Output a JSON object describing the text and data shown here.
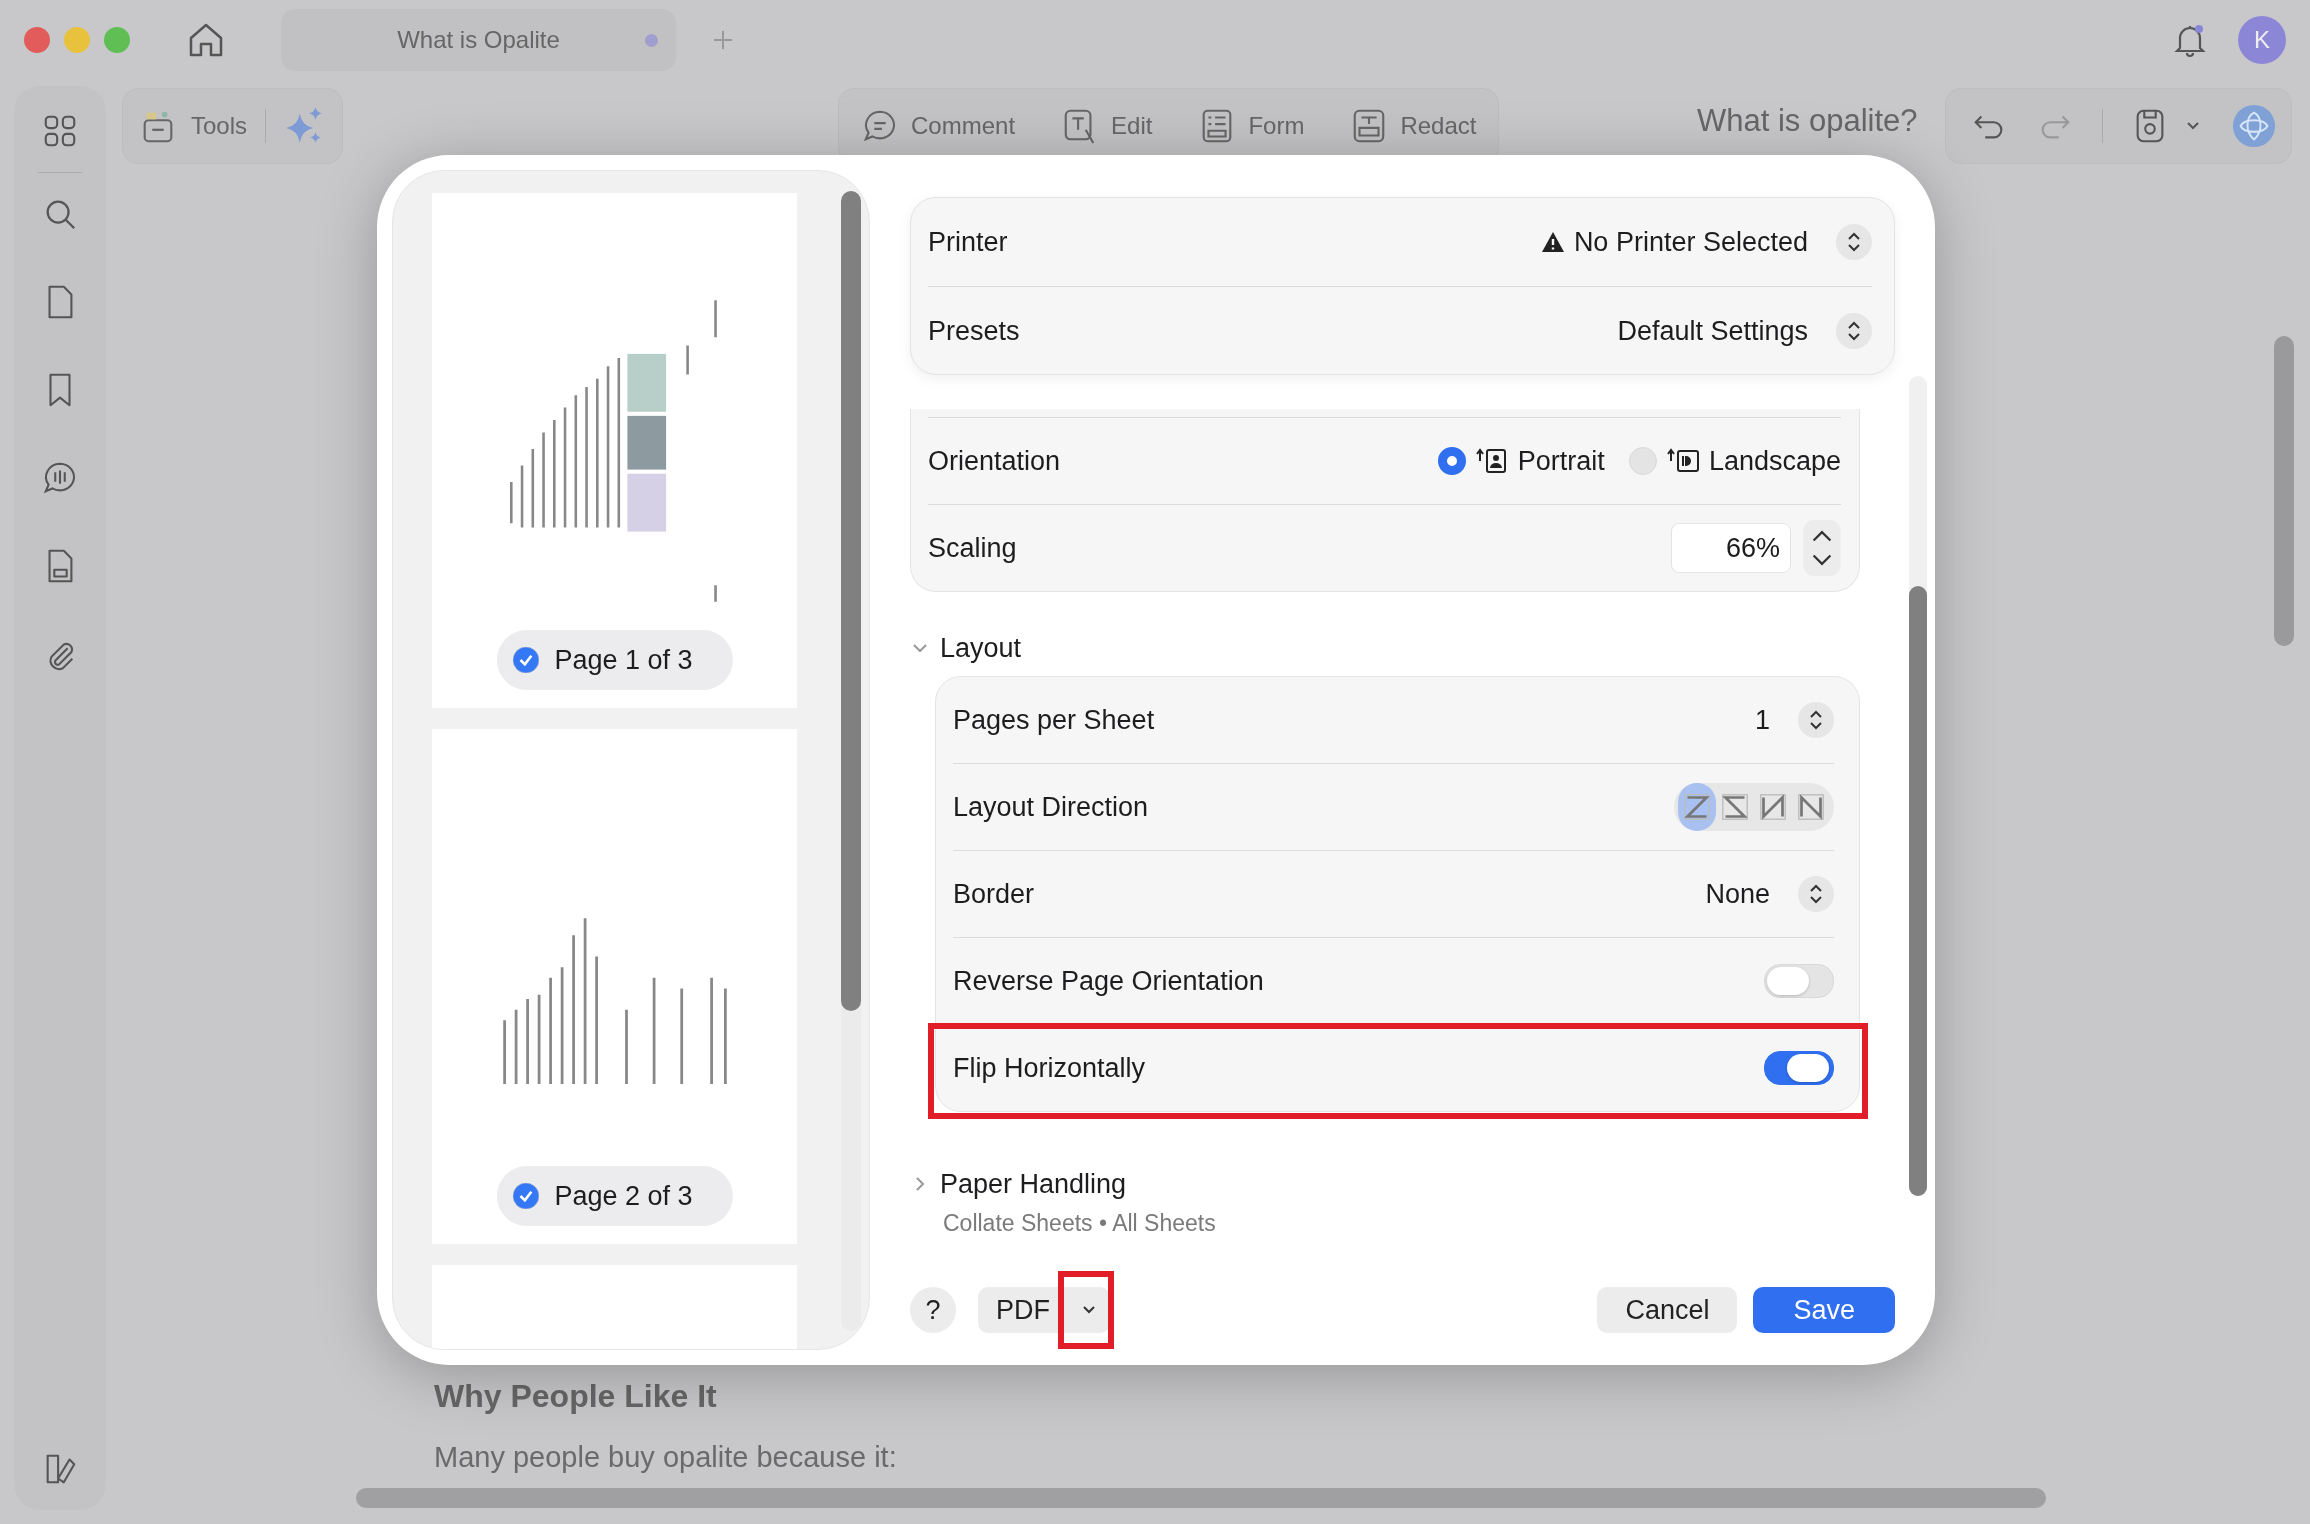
{
  "window": {
    "tab_title": "What is Opalite",
    "tab_unsaved": true,
    "notification": true,
    "avatar": "K"
  },
  "toolbar": {
    "tools_label": "Tools",
    "modes": [
      {
        "label": "Comment",
        "kind": "comment"
      },
      {
        "label": "Edit",
        "kind": "edit"
      },
      {
        "label": "Form",
        "kind": "form"
      },
      {
        "label": "Redact",
        "kind": "redact"
      }
    ],
    "document_title": "What is opalite?"
  },
  "document": {
    "heading": "Why People Like It",
    "text": "Many people buy opalite because it:"
  },
  "print_dialog": {
    "pages": [
      {
        "kind": "images",
        "label": "Page 1 of 3",
        "checked": true
      },
      {
        "kind": "table",
        "label": "Page 2 of 3",
        "checked": true
      },
      {
        "kind": "blank"
      }
    ],
    "printer": {
      "label": "Printer",
      "value": "No Printer Selected",
      "warning": true
    },
    "presets": {
      "label": "Presets",
      "value": "Default Settings"
    },
    "orientation": {
      "label": "Orientation",
      "options": [
        {
          "label": "Portrait",
          "selected": true
        },
        {
          "label": "Landscape",
          "selected": false
        }
      ]
    },
    "scaling": {
      "label": "Scaling",
      "value": "66%"
    },
    "layout": {
      "title": "Layout",
      "expanded": true,
      "rows": [
        {
          "kind": "select",
          "label": "Pages per Sheet",
          "value": "1",
          "highlighted": false
        },
        {
          "kind": "direction",
          "label": "Layout Direction",
          "options": [
            {
              "selected": true
            },
            {
              "selected": false
            },
            {
              "selected": false
            },
            {
              "selected": false
            }
          ],
          "highlighted": false
        },
        {
          "kind": "select",
          "label": "Border",
          "value": "None",
          "highlighted": false
        },
        {
          "kind": "toggle",
          "label": "Reverse Page Orientation",
          "on": false,
          "highlighted": false
        },
        {
          "kind": "toggle",
          "label": "Flip Horizontally",
          "on": true,
          "highlighted": true
        }
      ]
    },
    "paper_handling": {
      "title": "Paper Handling",
      "expanded": false,
      "summary": "Collate Sheets • All Sheets"
    },
    "footer": {
      "help": "?",
      "pdf": "PDF",
      "pdf_menu_highlighted": true,
      "cancel": "Cancel",
      "save": "Save"
    }
  }
}
